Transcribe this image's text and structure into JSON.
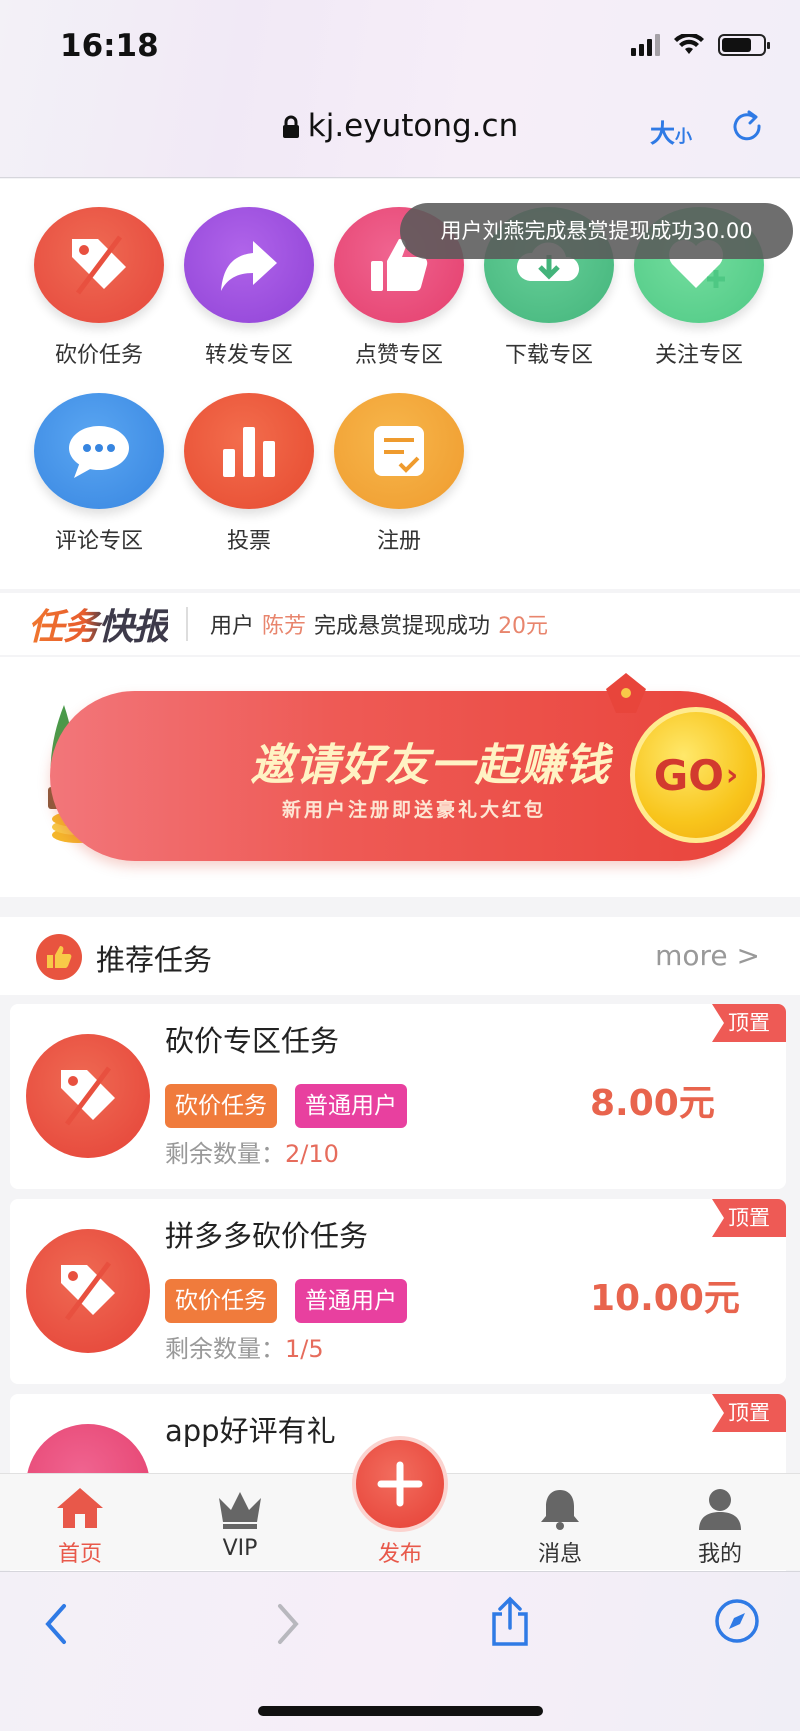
{
  "status_bar": {
    "time": "16:18"
  },
  "browser": {
    "url": "kj.eyutong.cn",
    "text_size_big": "大",
    "text_size_small": "小"
  },
  "toast": {
    "text": "用户刘燕完成悬赏提现成功30.00"
  },
  "categories": [
    {
      "label": "砍价任务",
      "icon": "price-tag-icon",
      "color": "#e8503f"
    },
    {
      "label": "转发专区",
      "icon": "share-arrow-icon",
      "color": "#9b4fdc"
    },
    {
      "label": "点赞专区",
      "icon": "thumbs-up-icon",
      "color": "#ea4a78"
    },
    {
      "label": "下载专区",
      "icon": "download-icon",
      "color": "#4fc18a"
    },
    {
      "label": "关注专区",
      "icon": "heart-plus-icon",
      "color": "#5fd191"
    },
    {
      "label": "评论专区",
      "icon": "chat-bubble-icon",
      "color": "#3f8fe8"
    },
    {
      "label": "投票",
      "icon": "bar-chart-icon",
      "color": "#ec5a3c"
    },
    {
      "label": "注册",
      "icon": "form-check-icon",
      "color": "#f2a43a"
    }
  ],
  "flash": {
    "logo": "任务快报",
    "prefix": "用户",
    "user": "陈芳",
    "middle": "完成悬赏提现成功",
    "amount": "20元"
  },
  "banner": {
    "title": "邀请好友一起赚钱",
    "subtitle": "新用户注册即送豪礼大红包",
    "button": "GO",
    "button_arrow": "›"
  },
  "recommended": {
    "title": "推荐任务",
    "more": "more >"
  },
  "tasks": [
    {
      "title": "砍价专区任务",
      "tag1": "砍价任务",
      "tag2": "普通用户",
      "remain_label": "剩余数量：",
      "remain": "2/10",
      "price": "8.00元",
      "badge": "顶置"
    },
    {
      "title": "拼多多砍价任务",
      "tag1": "砍价任务",
      "tag2": "普通用户",
      "remain_label": "剩余数量：",
      "remain": "1/5",
      "price": "10.00元",
      "badge": "顶置"
    },
    {
      "title": "app好评有礼",
      "badge": "顶置"
    }
  ],
  "bottom_nav": {
    "home": "首页",
    "vip": "VIP",
    "publish": "发布",
    "messages": "消息",
    "mine": "我的"
  },
  "colors": {
    "accent": "#e8584a",
    "link": "#2f7ae5"
  }
}
